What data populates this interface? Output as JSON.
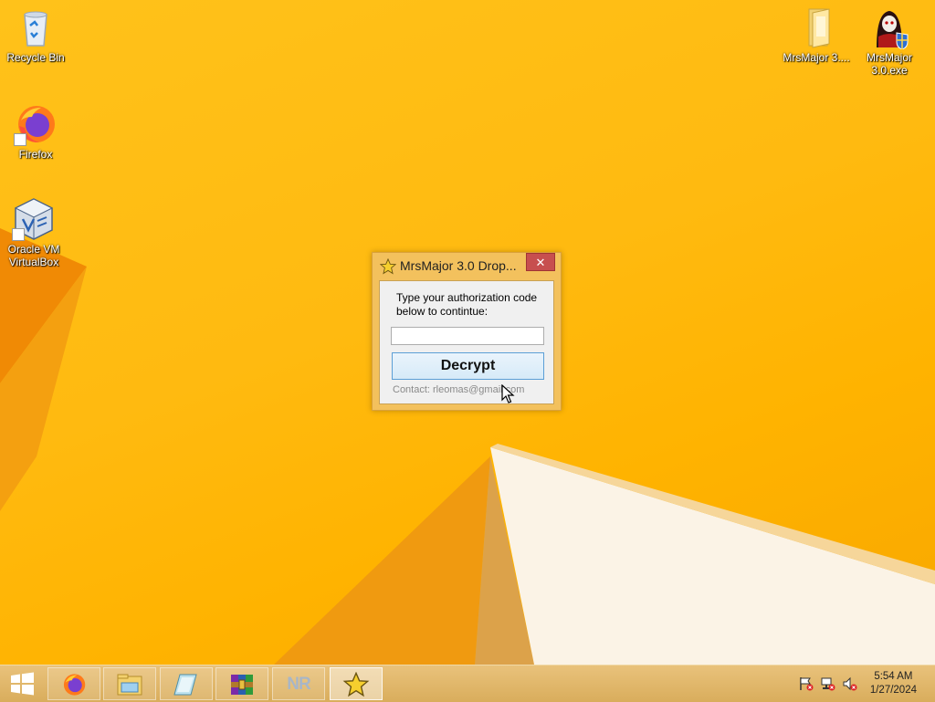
{
  "desktop": {
    "icons": [
      {
        "label": "Recycle Bin"
      },
      {
        "label": "Firefox"
      },
      {
        "label": "Oracle VM VirtualBox"
      },
      {
        "label": "MrsMajor 3...."
      },
      {
        "label": "MrsMajor 3.0.exe"
      }
    ]
  },
  "dialog": {
    "title": "MrsMajor 3.0 Drop...",
    "close_label": "✕",
    "prompt": "Type your authorization code below to contintue:",
    "code_value": "",
    "decrypt_label": "Decrypt",
    "contact": "Contact: rleomas@gmail.com"
  },
  "taskbar": {
    "items": [
      {
        "icon": "firefox-icon"
      },
      {
        "icon": "file-explorer-icon"
      },
      {
        "icon": "notebook-app-icon"
      },
      {
        "icon": "winrar-icon"
      },
      {
        "icon": "nr-app-icon",
        "label": "NR"
      },
      {
        "icon": "star-icon",
        "active": true
      }
    ],
    "tray": [
      "action-center-flag-icon",
      "network-icon",
      "volume-muted-icon"
    ],
    "time": "5:54 AM",
    "date": "1/27/2024"
  },
  "colors": {
    "wallpaper": "#ffb300",
    "taskbar": "#e0b66a",
    "close_button": "#c74f4f",
    "decrypt_border": "#5c9fd6"
  }
}
